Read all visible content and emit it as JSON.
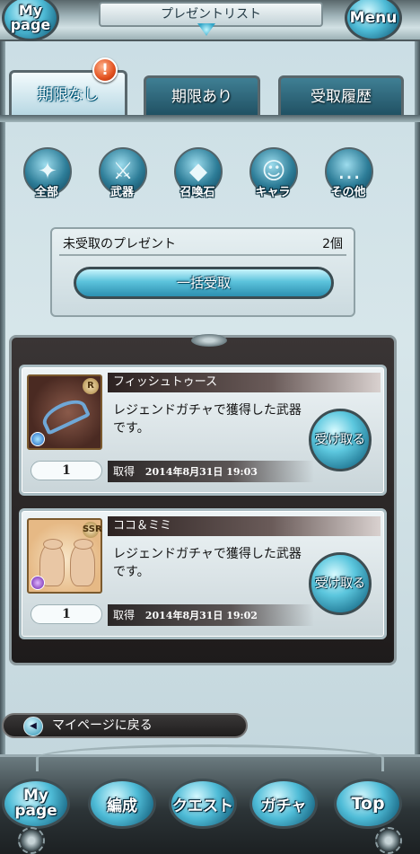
{
  "header": {
    "title": "プレゼントリスト",
    "mypage_label": "My page",
    "menu_label": "Menu"
  },
  "tabs": [
    {
      "label": "期限なし",
      "active": true,
      "has_alert": true
    },
    {
      "label": "期限あり",
      "active": false
    },
    {
      "label": "受取履歴",
      "active": false
    }
  ],
  "alert_badge": "!",
  "filters": [
    {
      "label": "全部",
      "icon": "all-items-icon"
    },
    {
      "label": "武器",
      "icon": "sword-icon"
    },
    {
      "label": "召喚石",
      "icon": "crystal-icon"
    },
    {
      "label": "キャラ",
      "icon": "character-icon"
    },
    {
      "label": "その他",
      "icon": "ellipsis-icon"
    }
  ],
  "unclaimed": {
    "title": "未受取のプレゼント",
    "count": "2個",
    "claim_all_label": "一括受取"
  },
  "presents": [
    {
      "name": "フィッシュトゥース",
      "rarity": "R",
      "element": "water",
      "description": "レジェンドガチャで獲得した武器です。",
      "quantity": "1",
      "obtained_label": "取得",
      "obtained_date": "2014年8月31日 19:03",
      "receive_label": "受け取る"
    },
    {
      "name": "ココ＆ミミ",
      "rarity": "SSR",
      "element": "dark",
      "description": "レジェンドガチャで獲得した武器です。",
      "quantity": "1",
      "obtained_label": "取得",
      "obtained_date": "2014年8月31日 19:02",
      "receive_label": "受け取る"
    }
  ],
  "back_link": "マイページに戻る",
  "footer_nav": [
    {
      "label": "My page"
    },
    {
      "label": "編成"
    },
    {
      "label": "クエスト"
    },
    {
      "label": "ガチャ"
    },
    {
      "label": "Top"
    }
  ],
  "colors": {
    "accent": "#4fbcd7",
    "alert": "#e2511f",
    "dark_panel": "#2b2727"
  }
}
